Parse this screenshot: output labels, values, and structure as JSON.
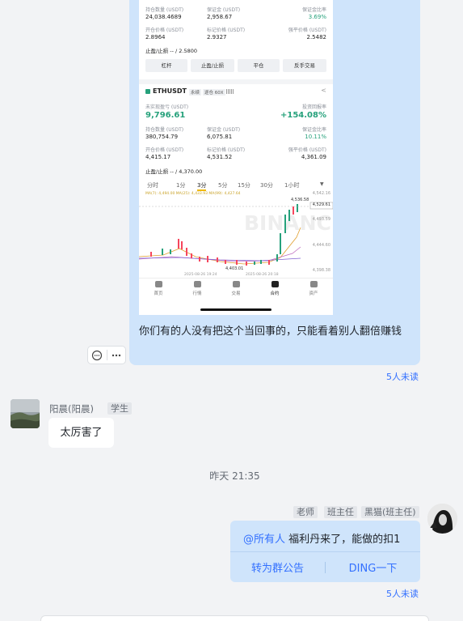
{
  "message1": {
    "text": "你们有的人没有把这个当回事的，只能看着别人翻倍赚钱",
    "unread": "5人未读",
    "screenshot": {
      "pos1": {
        "qty_label": "持仓数量 (USDT)",
        "qty": "24,038.4689",
        "margin_label": "保证金 (USDT)",
        "margin": "2,958.67",
        "ratio_label": "保证金比率",
        "ratio": "3.69%",
        "open_label": "开仓价格 (USDT)",
        "open": "2.8964",
        "mark_label": "标记价格 (USDT)",
        "mark": "2.9327",
        "liq_label": "强平价格 (USDT)",
        "liq": "2.5482",
        "tpsl": "止盈/止损 -- / 2.5800"
      },
      "buttons": [
        "杠杆",
        "止盈/止损",
        "平仓",
        "反手交易"
      ],
      "pos2": {
        "symbol": "ETHUSDT",
        "tag1": "永续",
        "tag2": "逐仓 60X",
        "pnl_label": "未实现盈亏 (USDT)",
        "pnl": "9,796.61",
        "roi_label": "投资回报率",
        "roi": "+154.08%",
        "qty_label": "持仓数量 (USDT)",
        "qty": "380,754.79",
        "margin_label": "保证金 (USDT)",
        "margin": "6,075.81",
        "ratio_label": "保证金比率",
        "ratio": "10.11%",
        "open_label": "开仓价格 (USDT)",
        "open": "4,415.17",
        "mark_label": "标记价格 (USDT)",
        "mark": "4,531.52",
        "liq_label": "强平价格 (USDT)",
        "liq": "4,361.09",
        "tpsl": "止盈/止损 -- / 4,370.00"
      },
      "timeframes": [
        "分时",
        "1分",
        "3分",
        "5分",
        "15分",
        "30分",
        "1小时"
      ],
      "active_timeframe": "3分",
      "ma_line": "MA(7): 4,494.00   MA(25): 4,433.93   MA(99): 4,427.64",
      "chart_prices": [
        "4,542.16",
        "4,529.61",
        "4,493.59",
        "4,444.60",
        "4,398.38"
      ],
      "chart_high": "4,536.58",
      "chart_low": "4,403.01",
      "chart_dates": [
        "2025-08-26 19:24",
        "2025-08-26 20:18"
      ],
      "watermark": "BINANCE",
      "nav": [
        "首页",
        "行情",
        "交易",
        "合约",
        "资产"
      ]
    }
  },
  "message2": {
    "sender": "阳晨(阳晨)",
    "role": "学生",
    "text": "太厉害了"
  },
  "time_separator": "昨天 21:35",
  "message3": {
    "tags": [
      "老师",
      "班主任",
      "黑猫(班主任)"
    ],
    "mention": "@所有人",
    "text": " 福利丹来了，能做的扣1",
    "action1": "转为群公告",
    "action2": "DING一下",
    "unread": "5人未读"
  },
  "colors": {
    "accent": "#3370ff",
    "bubble_out": "#cfe4fb",
    "profit": "#26a17b"
  }
}
